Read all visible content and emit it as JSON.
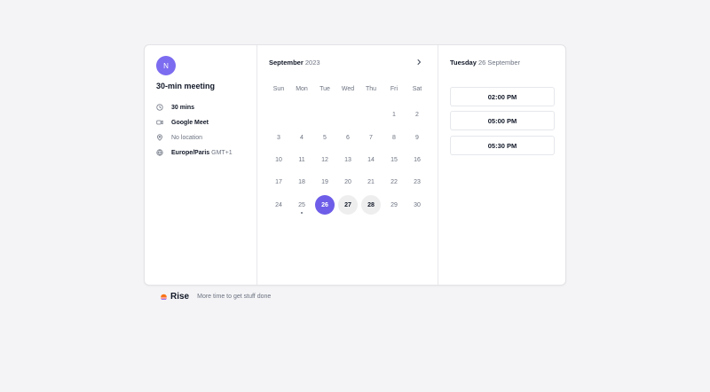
{
  "profile": {
    "avatar_initial": "N"
  },
  "event": {
    "title": "30-min meeting",
    "duration": "30 mins",
    "platform": "Google Meet",
    "location": "No location",
    "timezone": "Europe/Paris",
    "timezone_offset": "GMT+1"
  },
  "calendar": {
    "month": "September",
    "year": "2023",
    "weekdays": [
      "Sun",
      "Mon",
      "Tue",
      "Wed",
      "Thu",
      "Fri",
      "Sat"
    ],
    "days": [
      "1",
      "2",
      "3",
      "4",
      "5",
      "6",
      "7",
      "8",
      "9",
      "10",
      "11",
      "12",
      "13",
      "14",
      "15",
      "16",
      "17",
      "18",
      "19",
      "20",
      "21",
      "22",
      "23",
      "24",
      "25",
      "26",
      "27",
      "28",
      "29",
      "30"
    ]
  },
  "selected_date": {
    "weekday": "Tuesday",
    "date": "26 September"
  },
  "time_slots": [
    "02:00 PM",
    "05:00 PM",
    "05:30 PM"
  ],
  "footer": {
    "brand": "Rise",
    "tagline": "More time to get stuff done"
  },
  "colors": {
    "accent": "#6d5de8",
    "avatar": "#7c6cf0",
    "background": "#f4f4f6"
  },
  "icons": {
    "duration": "clock-icon",
    "platform": "video-icon",
    "location": "map-pin-icon",
    "timezone": "globe-icon",
    "next": "chevron-right-icon"
  }
}
